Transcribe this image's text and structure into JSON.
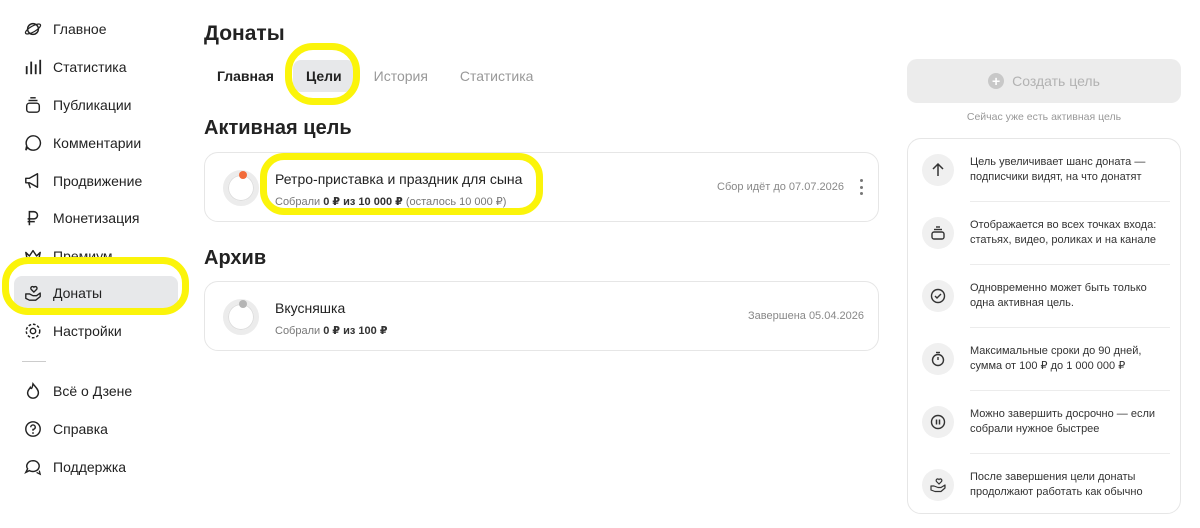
{
  "sidebar": {
    "items": [
      {
        "label": "Главное",
        "icon": "planet-icon"
      },
      {
        "label": "Статистика",
        "icon": "bar-chart-icon"
      },
      {
        "label": "Публикации",
        "icon": "stack-icon"
      },
      {
        "label": "Комментарии",
        "icon": "comment-icon"
      },
      {
        "label": "Продвижение",
        "icon": "megaphone-icon"
      },
      {
        "label": "Монетизация",
        "icon": "ruble-icon"
      },
      {
        "label": "Премиум",
        "icon": "crown-icon"
      },
      {
        "label": "Донаты",
        "icon": "donate-hand-icon"
      },
      {
        "label": "Настройки",
        "icon": "gear-icon"
      }
    ],
    "bottom_items": [
      {
        "label": "Всё о Дзене",
        "icon": "flame-icon"
      },
      {
        "label": "Справка",
        "icon": "help-icon"
      },
      {
        "label": "Поддержка",
        "icon": "chat-icon"
      }
    ],
    "active": "Донаты"
  },
  "page": {
    "title": "Донаты",
    "tabs": [
      "Главная",
      "Цели",
      "История",
      "Статистика"
    ],
    "active_tab": "Цели"
  },
  "active_goal": {
    "section_title": "Активная цель",
    "title": "Ретро-приставка и праздник для сына",
    "collected_prefix": "Собрали",
    "collected": "0 ₽",
    "of_word": "из",
    "target": "10 000 ₽",
    "remaining": "(осталось 10 000 ₽)",
    "status": "Сбор идёт до 07.07.2026",
    "ring_color": "#f26b3a"
  },
  "archive": {
    "section_title": "Архив",
    "title": "Вкусняшка",
    "collected_prefix": "Собрали",
    "collected": "0 ₽",
    "of_word": "из",
    "target": "100 ₽",
    "status": "Завершена 05.04.2026",
    "ring_color": "#b5b5b5"
  },
  "right": {
    "create_button": "Создать цель",
    "note": "Сейчас уже есть активная цель",
    "info": [
      {
        "icon": "arrow-up-icon",
        "text": "Цель увеличивает шанс доната — подписчики видят, на что донатят"
      },
      {
        "icon": "stack-icon",
        "text": "Отображается во всех точках входа: статьях, видео, роликах и на канале"
      },
      {
        "icon": "check-circle-icon",
        "text": "Одновременно может быть только одна активная цель."
      },
      {
        "icon": "stopwatch-icon",
        "text": "Максимальные сроки до 90 дней, сумма от 100 ₽ до 1 000 000 ₽"
      },
      {
        "icon": "pause-icon",
        "text": "Можно завершить досрочно — если собрали нужное быстрее"
      },
      {
        "icon": "donate-hand-icon",
        "text": "После завершения цели донаты продолжают работать как обычно"
      }
    ]
  },
  "colors": {
    "highlight": "#fbf40a",
    "active_bg": "#e7e8ea"
  }
}
